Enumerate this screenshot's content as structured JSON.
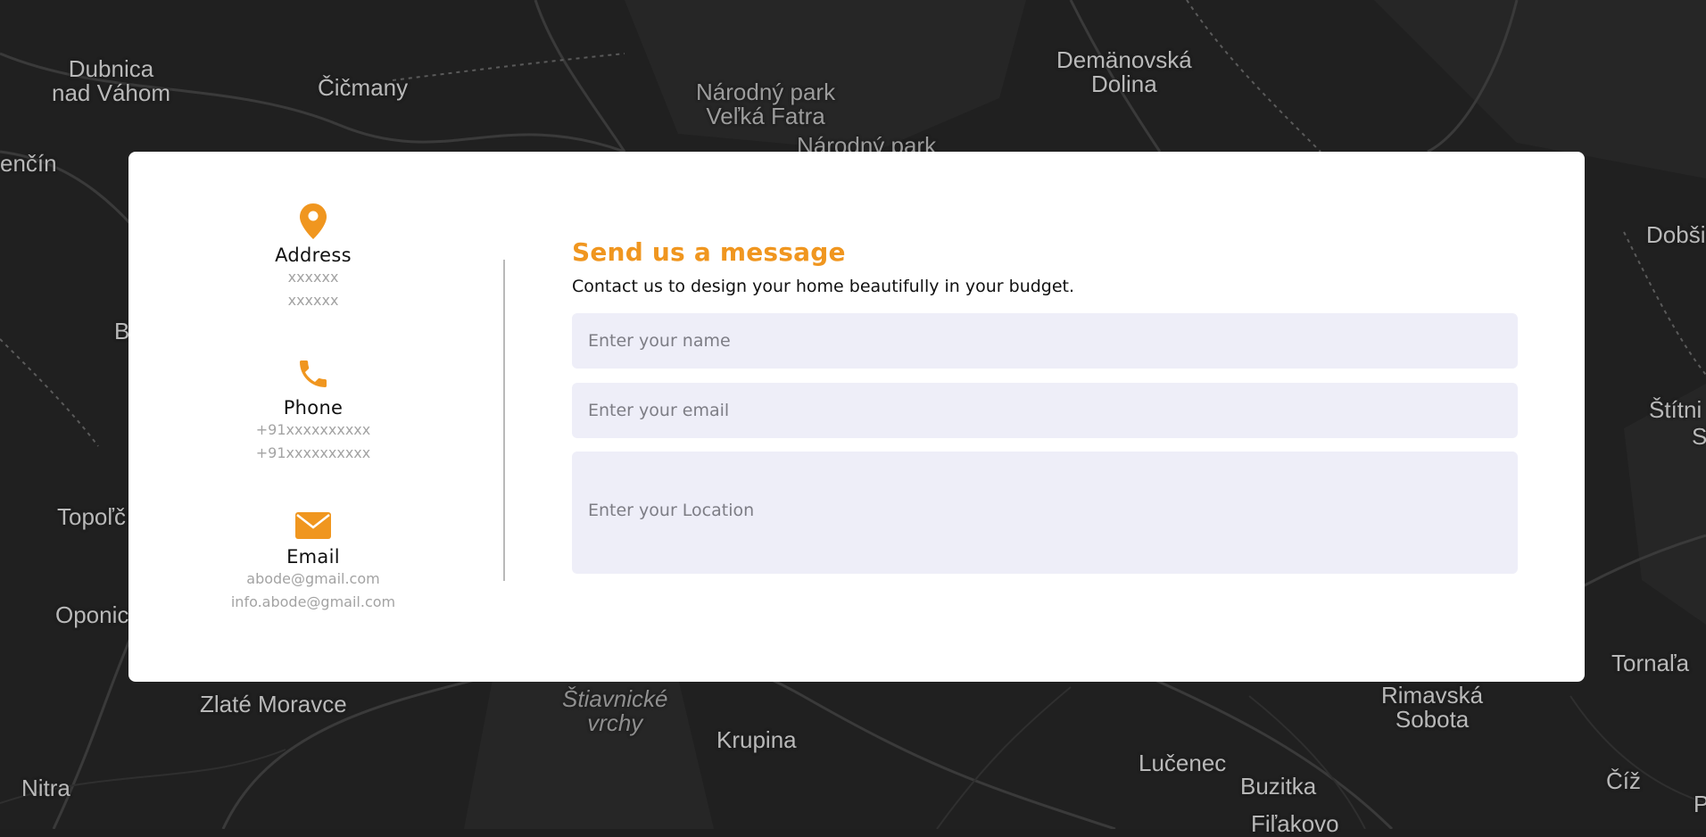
{
  "map": {
    "labels": [
      {
        "id": "dubnica",
        "text": "Dubnica\nnad Váhom",
        "cls": ""
      },
      {
        "id": "cicmany",
        "text": "Čičmany",
        "cls": ""
      },
      {
        "id": "velka-fatra",
        "text": "Národný park\nVeľká Fatra",
        "cls": "park"
      },
      {
        "id": "narodny-park-2",
        "text": "Národný park",
        "cls": "park"
      },
      {
        "id": "demanovska",
        "text": "Demänovská\nDolina",
        "cls": ""
      },
      {
        "id": "trencin",
        "text": "enčín",
        "cls": ""
      },
      {
        "id": "dobsina",
        "text": "Dobši",
        "cls": ""
      },
      {
        "id": "b",
        "text": "B",
        "cls": ""
      },
      {
        "id": "stitnik",
        "text": "Štítni",
        "cls": ""
      },
      {
        "id": "s",
        "text": "S",
        "cls": ""
      },
      {
        "id": "topolcany",
        "text": "Topoľč",
        "cls": ""
      },
      {
        "id": "oponice",
        "text": "Oponic",
        "cls": ""
      },
      {
        "id": "tornala",
        "text": "Tornaľa",
        "cls": ""
      },
      {
        "id": "zlate-moravce",
        "text": "Zlaté Moravce",
        "cls": ""
      },
      {
        "id": "stiavnicke",
        "text": "Štiavnické\nvrchy",
        "cls": "italic"
      },
      {
        "id": "krupina",
        "text": "Krupina",
        "cls": ""
      },
      {
        "id": "rimavska",
        "text": "Rimavská\nSobota",
        "cls": ""
      },
      {
        "id": "nitra",
        "text": "Nitra",
        "cls": ""
      },
      {
        "id": "lucenec",
        "text": "Lučenec",
        "cls": ""
      },
      {
        "id": "buzitka",
        "text": "Buzitka",
        "cls": ""
      },
      {
        "id": "filakovo",
        "text": "Fiľakovo",
        "cls": ""
      },
      {
        "id": "ciz",
        "text": "Číž",
        "cls": ""
      },
      {
        "id": "p",
        "text": "P",
        "cls": ""
      }
    ]
  },
  "contact": {
    "address": {
      "title": "Address",
      "line1": "xxxxxx",
      "line2": "xxxxxx",
      "icon": "map-pin-icon"
    },
    "phone": {
      "title": "Phone",
      "line1": "+91xxxxxxxxxx",
      "line2": "+91xxxxxxxxxx",
      "icon": "phone-icon"
    },
    "email": {
      "title": "Email",
      "line1": "abode@gmail.com",
      "line2": "info.abode@gmail.com",
      "icon": "envelope-icon"
    }
  },
  "form": {
    "title": "Send us a message",
    "subtitle": "Contact us to design your home beautifully in your budget.",
    "name_placeholder": "Enter your name",
    "email_placeholder": "Enter your email",
    "location_placeholder": "Enter your Location"
  },
  "colors": {
    "accent": "#f0961f",
    "field_bg": "#eeeef8",
    "map_bg": "#1f1f1f"
  }
}
